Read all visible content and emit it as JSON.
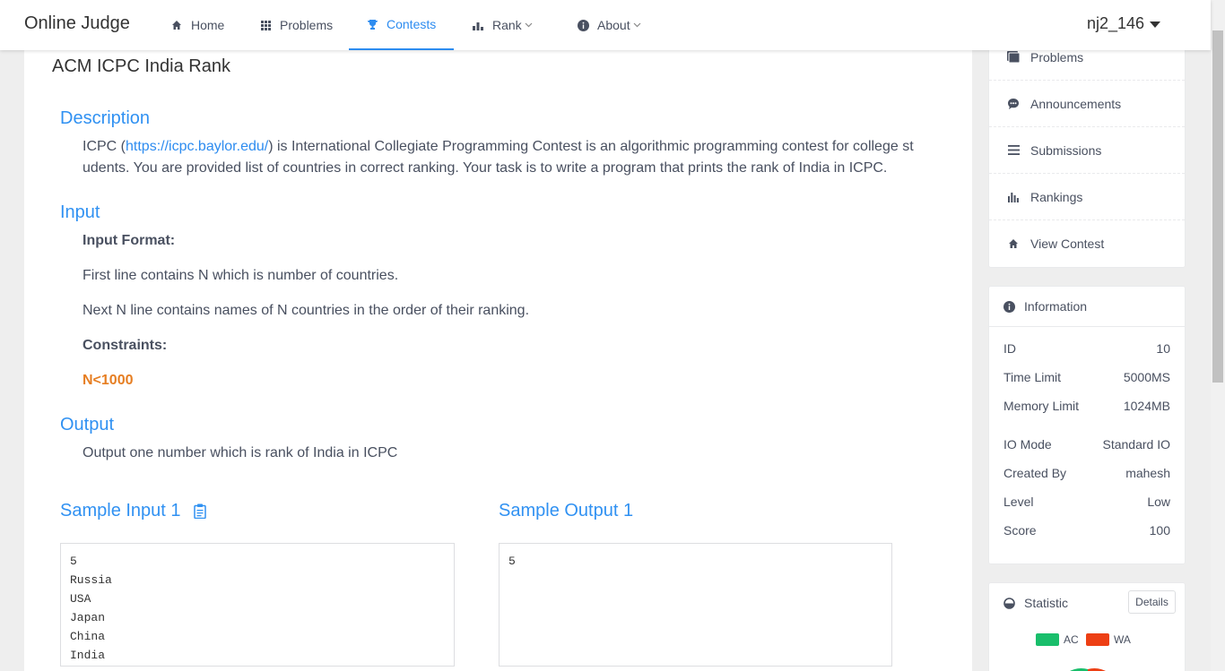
{
  "app": {
    "title": "Online Judge"
  },
  "nav": {
    "home": "Home",
    "problems": "Problems",
    "contests": "Contests",
    "rank": "Rank",
    "about": "About"
  },
  "user": {
    "name": "nj2_146"
  },
  "problem": {
    "title": "ACM ICPC India Rank",
    "description_title": "Description",
    "description_pre": "ICPC (",
    "description_link": "https://icpc.baylor.edu/",
    "description_post_line1": ") is International Collegiate Programming Contest is an algorithmic programming contest for college st",
    "description_line2": "udents. You are provided list of countries in correct ranking. Your task is to write a program that prints the rank of India in ICPC.",
    "input_title": "Input",
    "input_format_label": "Input Format:",
    "input_line1": "First line contains N which is number of countries.",
    "input_line2": "Next N line contains names of N countries in the order of their ranking.",
    "constraints_label": "Constraints:",
    "constraint_value": "N<1000",
    "output_title": "Output",
    "output_text": "Output one number which is rank of India in ICPC",
    "sample_input_title": "Sample Input 1",
    "sample_output_title": "Sample Output 1",
    "sample_input": "5\nRussia\nUSA\nJapan\nChina\nIndia",
    "sample_output": "5"
  },
  "sidebar": {
    "menu": [
      {
        "label": "Problems",
        "icon": "book-icon"
      },
      {
        "label": "Announcements",
        "icon": "chat-icon"
      },
      {
        "label": "Submissions",
        "icon": "list-icon"
      },
      {
        "label": "Rankings",
        "icon": "bar-chart-icon"
      },
      {
        "label": "View Contest",
        "icon": "home-icon"
      }
    ],
    "info": {
      "title": "Information",
      "rows": [
        {
          "label": "ID",
          "value": "10"
        },
        {
          "label": "Time Limit",
          "value": "5000MS"
        },
        {
          "label": "Memory Limit",
          "value": "1024MB"
        },
        {
          "label": "IO Mode",
          "value": "Standard IO"
        },
        {
          "label": "Created By",
          "value": "mahesh"
        },
        {
          "label": "Level",
          "value": "Low"
        },
        {
          "label": "Score",
          "value": "100"
        }
      ]
    },
    "statistic": {
      "title": "Statistic",
      "details": "Details",
      "legend": [
        {
          "label": "AC",
          "color": "#19be6b"
        },
        {
          "label": "WA",
          "color": "#ed3f14"
        }
      ]
    }
  },
  "colors": {
    "accent": "#2d8cf0",
    "constraint": "#e67e22"
  }
}
